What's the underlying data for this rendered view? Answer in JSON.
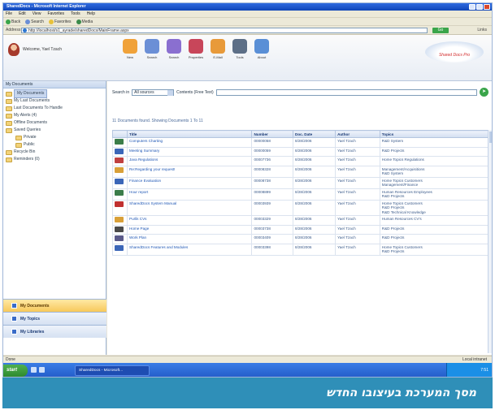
{
  "window": {
    "title": "SharedDocs - Microsoft Internet Explorer",
    "menu": [
      "File",
      "Edit",
      "View",
      "Favorites",
      "Tools",
      "Help"
    ],
    "ie_toolbar": [
      "Back",
      "Search",
      "Favorites",
      "Media"
    ],
    "address_label": "Address",
    "address_value": "http://localhost/s1_ayrade/sharedDocs/MainFrame.aspx",
    "go_label": "Go",
    "links_label": "Links"
  },
  "header": {
    "welcome": "Welcome, Yael Tzach",
    "toolbar": [
      {
        "label": "New",
        "icon": "new-document-icon",
        "color": "#f0a23a"
      },
      {
        "label": "Search",
        "icon": "search-icon",
        "color": "#6b8fd6"
      },
      {
        "label": "Search",
        "icon": "advanced-search-icon",
        "color": "#8a6fd0"
      },
      {
        "label": "Properties",
        "icon": "properties-icon",
        "color": "#c8465a"
      },
      {
        "label": "E-Mail",
        "icon": "email-icon",
        "color": "#e89a3a"
      },
      {
        "label": "Tools",
        "icon": "tools-icon",
        "color": "#5d6f87"
      },
      {
        "label": "About",
        "icon": "about-icon",
        "color": "#5a8fd6"
      }
    ],
    "logo_text": "Shared Docs Pro"
  },
  "sidebar": {
    "title": "My Documents",
    "tree": [
      {
        "label": "My Documents",
        "level": 0,
        "selected": true
      },
      {
        "label": "My Last Documents",
        "level": 0
      },
      {
        "label": "Last Documents To Handle",
        "level": 0
      },
      {
        "label": "My Alerts (4)",
        "level": 0
      },
      {
        "label": "Offline Documents",
        "level": 0
      },
      {
        "label": "Saved Queries",
        "level": 0
      },
      {
        "label": "Private",
        "level": 1
      },
      {
        "label": "Public",
        "level": 1
      },
      {
        "label": "Recycle Bin",
        "level": 0
      },
      {
        "label": "Reminders (0)",
        "level": 0
      }
    ],
    "nav": [
      {
        "label": "My Documents",
        "active": true
      },
      {
        "label": "My Topics"
      },
      {
        "label": "My Libraries"
      }
    ]
  },
  "search": {
    "label": "Search in",
    "scope": "All sources",
    "contents_label": "Contents (Free Text)",
    "go_icon": "go-arrow-icon"
  },
  "count_text": "11 Documents found. Showing Documents 1 To 11",
  "table": {
    "columns": [
      "Title",
      "Number",
      "Doc. Date",
      "Author",
      "Topics"
    ],
    "rows": [
      {
        "icon_color": "#3b7d4a",
        "title": "Computers Charting",
        "number": "00000058",
        "date": "8/28/2006",
        "author": "Yael Tzach",
        "topics": "R&D System"
      },
      {
        "icon_color": "#3b66b8",
        "title": "Meeting Summary",
        "number": "00000059",
        "date": "8/28/2006",
        "author": "Yael Tzach",
        "topics": "R&D Projects"
      },
      {
        "icon_color": "#c04040",
        "title": "Java Regulations",
        "number": "00007736",
        "date": "8/28/2006",
        "author": "Yael Tzach",
        "topics": "Home Topics Regulations"
      },
      {
        "icon_color": "#d9a038",
        "title": "Re:Regarding your request!",
        "number": "00008328",
        "date": "8/28/2006",
        "author": "Yael Tzach",
        "topics": "Management/Acquisitions\nR&D System"
      },
      {
        "icon_color": "#3b66b8",
        "title": "Finance Evaluation",
        "number": "00008738",
        "date": "8/28/2006",
        "author": "Yael Tzach",
        "topics": "Home Topics Customers\nManagement/Finance"
      },
      {
        "icon_color": "#3b7d4a",
        "title": "Hour report",
        "number": "00008899",
        "date": "8/28/2006",
        "author": "Yael Tzach",
        "topics": "Human Resources Employees\nR&D Projects"
      },
      {
        "icon_color": "#c03030",
        "title": "SharedDocs System Manual",
        "number": "00003939",
        "date": "8/28/2006",
        "author": "Yael Tzach",
        "topics": "Home Topics Customers\nR&D Projects\nR&D Technical Knowledge"
      },
      {
        "icon_color": "#d9a038",
        "title": "Purlik CVs",
        "number": "00003329",
        "date": "8/28/2006",
        "author": "Yael Tzach",
        "topics": "Human Resources CV's"
      },
      {
        "icon_color": "#4a4a4a",
        "title": "Home Page",
        "number": "00003738",
        "date": "8/28/2006",
        "author": "Yael Tzach",
        "topics": "R&D Projects"
      },
      {
        "icon_color": "#5a5a8a",
        "title": "Work Plan",
        "number": "00003409",
        "date": "8/28/2006",
        "author": "Yael Tzach",
        "topics": "R&D Projects"
      },
      {
        "icon_color": "#3b66b8",
        "title": "SharedDocs Features and Modules",
        "number": "00003398",
        "date": "8/28/2006",
        "author": "Yael Tzach",
        "topics": "Home Topics Customers\nR&D Projects"
      }
    ]
  },
  "status": {
    "left": "Done",
    "zone": "Local intranet"
  },
  "taskbar": {
    "start": "start",
    "item": "SharedDocs - Microsoft...",
    "clock": "7:51"
  },
  "caption": "מסך המערכת בעיצובו החדש"
}
